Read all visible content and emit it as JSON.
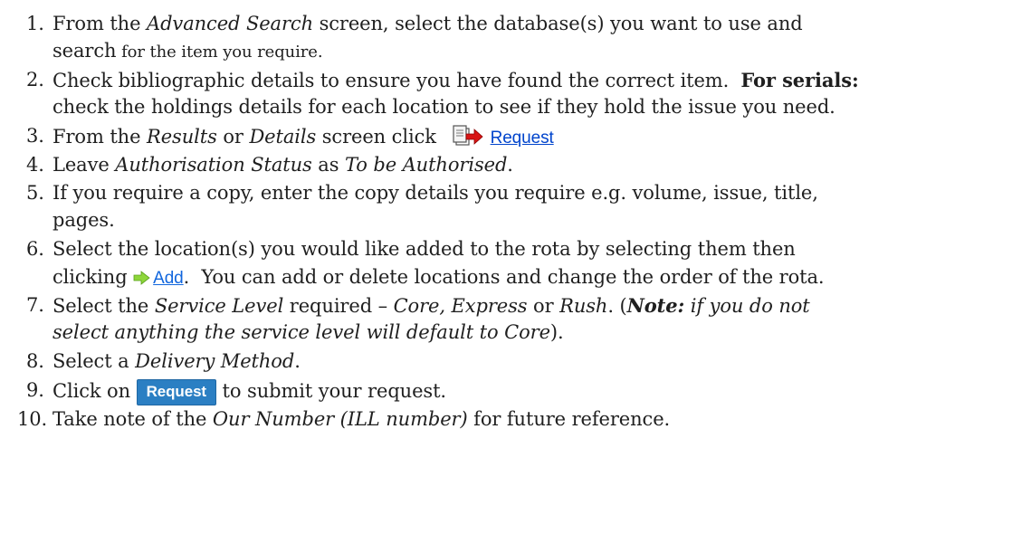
{
  "steps": [
    {
      "num": "1.",
      "l1_pre": "From the ",
      "l1_em": "Advanced Search",
      "l1_post": " screen, select the database(s) you want to use and",
      "l2_a": "search",
      "l2_b": " for the item you require."
    },
    {
      "num": "2.",
      "l1_pre": "Check bibliographic details to ensure you have found the correct item.  ",
      "l1_bold": "For serials:",
      "l2": "check the holdings details for each location to see if they hold the issue you need."
    },
    {
      "num": "3.",
      "l1_pre": "From the ",
      "em1": "Results",
      "mid": " or ",
      "em2": "Details",
      "post": " screen click ",
      "link": "Request",
      "icon": "request-document-icon"
    },
    {
      "num": "4.",
      "pre": "Leave ",
      "em1": "Authorisation Status",
      "mid": " as ",
      "em2": "To be Authorised",
      "post": "."
    },
    {
      "num": "5.",
      "l1": "If you require a copy, enter the copy details you require e.g. volume, issue, title,",
      "l2": "pages."
    },
    {
      "num": "6.",
      "l1": "Select the location(s) you would like added to the rota by selecting them then",
      "l2_pre": "clicking ",
      "link": "Add",
      "l2_post": ".  You can add or delete locations and change the order of the rota.",
      "icon": "green-arrow-icon"
    },
    {
      "num": "7.",
      "l1_pre": "Select the ",
      "em1": "Service Level",
      "mid1": " required – ",
      "em2": "Core, Express",
      "mid2": " or ",
      "em3": "Rush",
      "mid3": ". (",
      "note_bold": "Note:",
      "note_rest": " if you do not",
      "l2_em": "select anything the service level will default to Core",
      "l2_post": ")."
    },
    {
      "num": "8.",
      "pre": "Select a ",
      "em": "Delivery Method",
      "post": "."
    },
    {
      "num": "9.",
      "pre": "Click on ",
      "button": "Request",
      "post": " to submit your request."
    },
    {
      "num": "10.",
      "pre": "Take note of the ",
      "em": "Our Number (ILL number)",
      "post": " for future reference."
    }
  ],
  "colors": {
    "link": "#0044cc",
    "button_bg": "#2b7fc3",
    "arrow": "#8ed63a"
  }
}
